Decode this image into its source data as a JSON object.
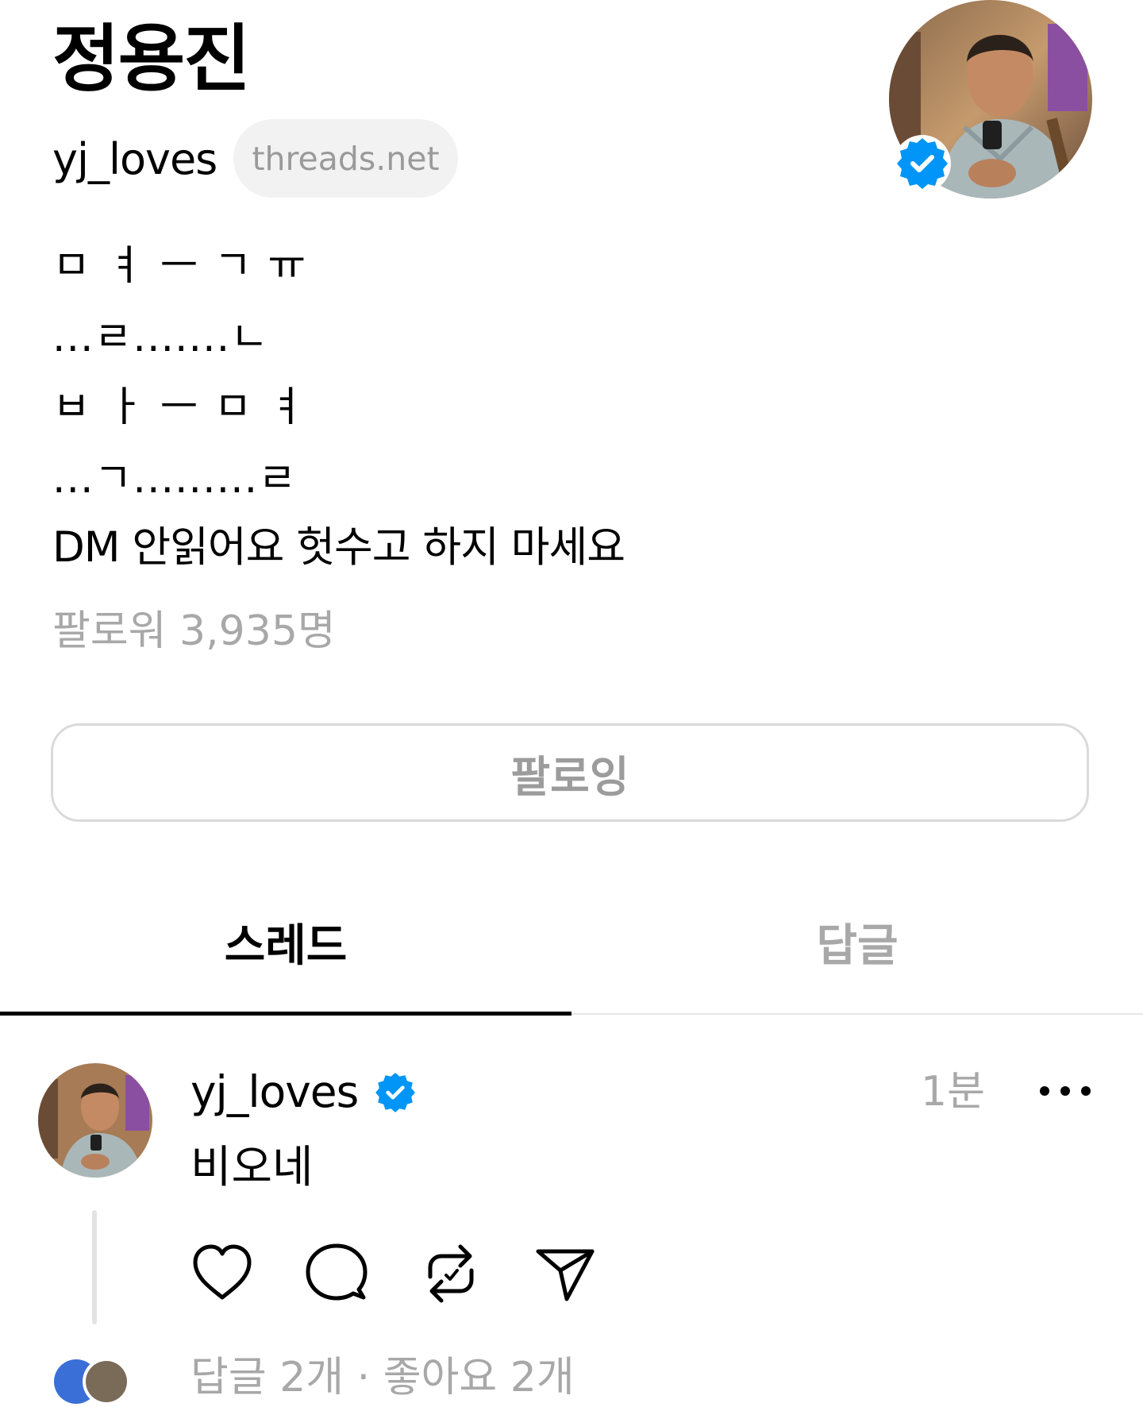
{
  "profile": {
    "display_name": "정용진",
    "username": "yj_loves",
    "domain_badge": "threads.net",
    "bio_lines": [
      "ㅁㅕㅡㄱㅠ",
      "...ㄹ.......ㄴ",
      "ㅂㅏㅡㅁㅕ",
      "...ㄱ.........ㄹ",
      "DM 안읽어요 헛수고 하지 마세요"
    ],
    "followers_text": "팔로워 3,935명",
    "follow_button_label": "팔로잉"
  },
  "tabs": [
    {
      "label": "스레드",
      "active": true
    },
    {
      "label": "답글",
      "active": false
    }
  ],
  "post": {
    "username": "yj_loves",
    "time": "1분",
    "text": "비오네",
    "stats_text": "답글 2개 · 좋아요 2개"
  },
  "icons": {
    "verified": "verified-badge-icon",
    "more": "more-horizontal-icon",
    "like": "heart-icon",
    "comment": "comment-icon",
    "repost": "repost-icon",
    "share": "send-icon"
  },
  "colors": {
    "verified_blue": "#0095f6",
    "muted_text": "#a8a8a8",
    "pill_bg": "#f2f2f2"
  }
}
